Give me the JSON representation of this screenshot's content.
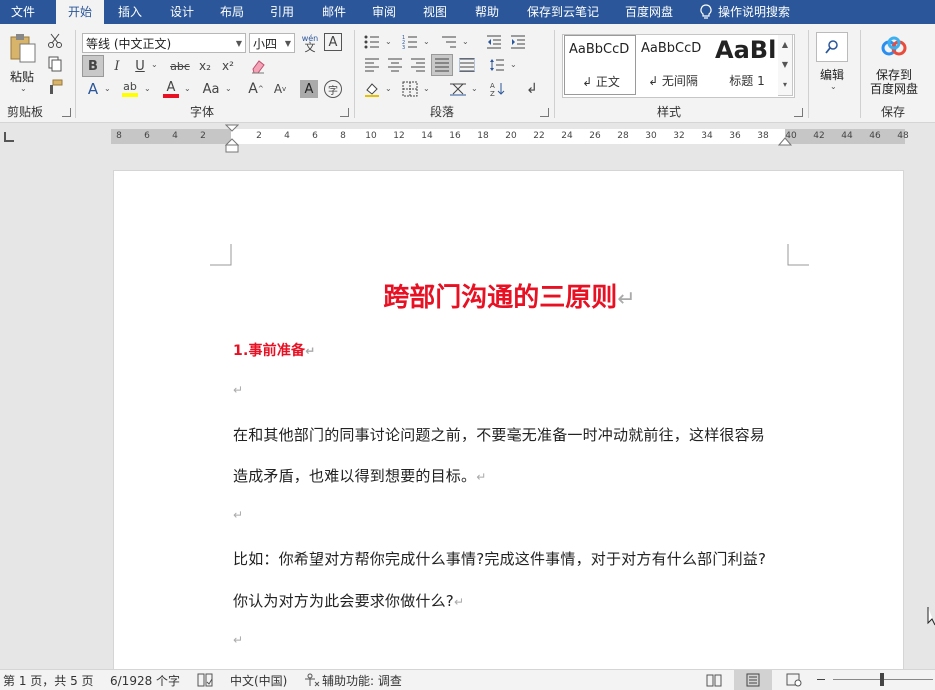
{
  "tabs": [
    {
      "name": "file",
      "label": "文件"
    },
    {
      "name": "home",
      "label": "开始",
      "active": true
    },
    {
      "name": "insert",
      "label": "插入"
    },
    {
      "name": "design",
      "label": "设计"
    },
    {
      "name": "layout",
      "label": "布局"
    },
    {
      "name": "references",
      "label": "引用"
    },
    {
      "name": "mailings",
      "label": "邮件"
    },
    {
      "name": "review",
      "label": "审阅"
    },
    {
      "name": "view",
      "label": "视图"
    },
    {
      "name": "help",
      "label": "帮助"
    },
    {
      "name": "save-cloud-note",
      "label": "保存到云笔记"
    },
    {
      "name": "baidu-netdisk",
      "label": "百度网盘"
    }
  ],
  "tell_me": {
    "label": "操作说明搜索",
    "icon": "lightbulb-icon"
  },
  "ribbon": {
    "clipboard": {
      "label": "剪贴板",
      "paste_label": "粘贴",
      "icons": [
        "paste-icon",
        "cut-icon",
        "copy-icon",
        "format-painter-icon"
      ]
    },
    "font": {
      "label": "字体",
      "font_name": "等线 (中文正文)",
      "font_size": "小四",
      "phonetic_top": "wén",
      "phonetic_bottom": "文",
      "bold": "B",
      "italic": "I",
      "underline": "U",
      "strike": "abc",
      "subscript": "x₂",
      "superscript": "x²",
      "grow": "A",
      "shrink": "A",
      "case": "Aa",
      "shade": "A",
      "enclose": "字",
      "text_effect": "A",
      "highlight": "ab",
      "font_color": "A",
      "colors": {
        "font_color": "#e81123",
        "highlight": "#ffff00"
      }
    },
    "paragraph": {
      "label": "段落"
    },
    "styles": {
      "label": "样式",
      "items": [
        {
          "preview": "AaBbCcD",
          "name": "↲ 正文",
          "selected": true
        },
        {
          "preview": "AaBbCcD",
          "name": "↲ 无间隔"
        },
        {
          "preview": "AaBl",
          "name": "标题 1"
        }
      ]
    },
    "editing": {
      "label": "编辑",
      "icon": "search-icon"
    },
    "save": {
      "group_label": "保存",
      "button_line1": "保存到",
      "button_line2": "百度网盘",
      "icon": "baidu-cloud-icon"
    }
  },
  "ruler": {
    "left_numbers": [
      "8",
      "6",
      "4",
      "2"
    ],
    "numbers": [
      "2",
      "4",
      "6",
      "8",
      "10",
      "12",
      "14",
      "16",
      "18",
      "20",
      "22",
      "24",
      "26",
      "28",
      "30",
      "32",
      "34",
      "36",
      "38",
      "40",
      "42",
      "44",
      "46",
      "48"
    ]
  },
  "document": {
    "title": "跨部门沟通的三原则",
    "title_color": "#e81123",
    "para_mark": "↵",
    "heading": "1.事前准备",
    "lines": [
      "在和其他部门的同事讨论问题之前，不要毫无准备一时冲动就前往，这样很容易",
      "造成矛盾，也难以得到想要的目标。",
      "比如：你希望对方帮你完成什么事情?完成这件事情，对于对方有什么部门利益?",
      "你认为对方为此会要求你做什么?"
    ]
  },
  "status": {
    "page": "第 1 页，共 5 页",
    "words": "6/1928 个字",
    "language": "中文(中国)",
    "accessibility": "辅助功能: 调查"
  }
}
